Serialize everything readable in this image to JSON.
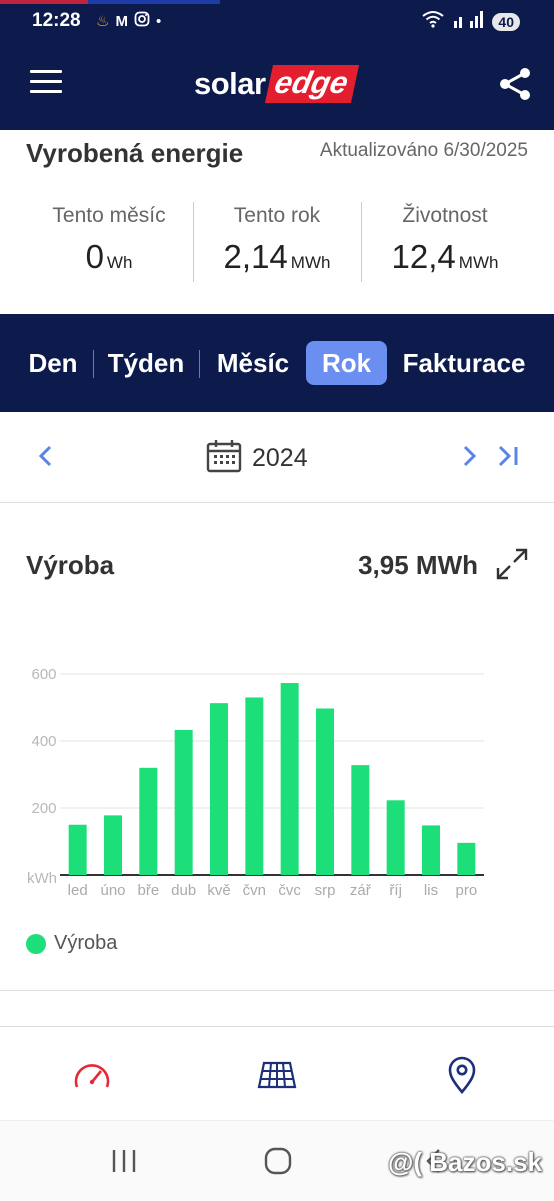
{
  "status_bar": {
    "time": "12:28",
    "battery": "40",
    "icons": [
      "fire-icon",
      "gmail-icon",
      "instagram-icon",
      "dot-icon",
      "wifi-icon",
      "signal-icon"
    ]
  },
  "header": {
    "logo_part1": "solar",
    "logo_part2": "edge",
    "menu_icon": "hamburger-menu-icon",
    "share_icon": "share-icon"
  },
  "energy": {
    "title": "Vyrobená energie",
    "updated": "Aktualizováno 6/30/2025",
    "stats": [
      {
        "label": "Tento měsíc",
        "value": "0",
        "unit": "Wh"
      },
      {
        "label": "Tento rok",
        "value": "2,14",
        "unit": "MWh"
      },
      {
        "label": "Životnost",
        "value": "12,4",
        "unit": "MWh"
      }
    ]
  },
  "tabs": [
    {
      "label": "Den",
      "active": false
    },
    {
      "label": "Týden",
      "active": false
    },
    {
      "label": "Měsíc",
      "active": false
    },
    {
      "label": "Rok",
      "active": true
    },
    {
      "label": "Fakturace",
      "active": false
    }
  ],
  "period": {
    "year": "2024"
  },
  "production": {
    "title": "Výroba",
    "total": "3,95 MWh",
    "legend": "Výroba",
    "color": "#1ddf7a"
  },
  "chart_data": {
    "type": "bar",
    "categories": [
      "led",
      "úno",
      "bře",
      "dub",
      "kvě",
      "čvn",
      "čvc",
      "srp",
      "zář",
      "říj",
      "lis",
      "pro"
    ],
    "series": [
      {
        "name": "Výroba",
        "values": [
          150,
          178,
          320,
          433,
          513,
          530,
          573,
          497,
          328,
          223,
          148,
          96
        ]
      }
    ],
    "ylabel": "kWh",
    "ylim": [
      0,
      600
    ],
    "yticks": [
      200,
      400,
      600
    ],
    "grid": true,
    "legend": "bottom-left"
  },
  "bottom_nav": {
    "items": [
      "dashboard-gauge-icon",
      "solar-panel-layout-icon",
      "location-pin-icon"
    ]
  },
  "watermark": "@( Bazos.sk"
}
